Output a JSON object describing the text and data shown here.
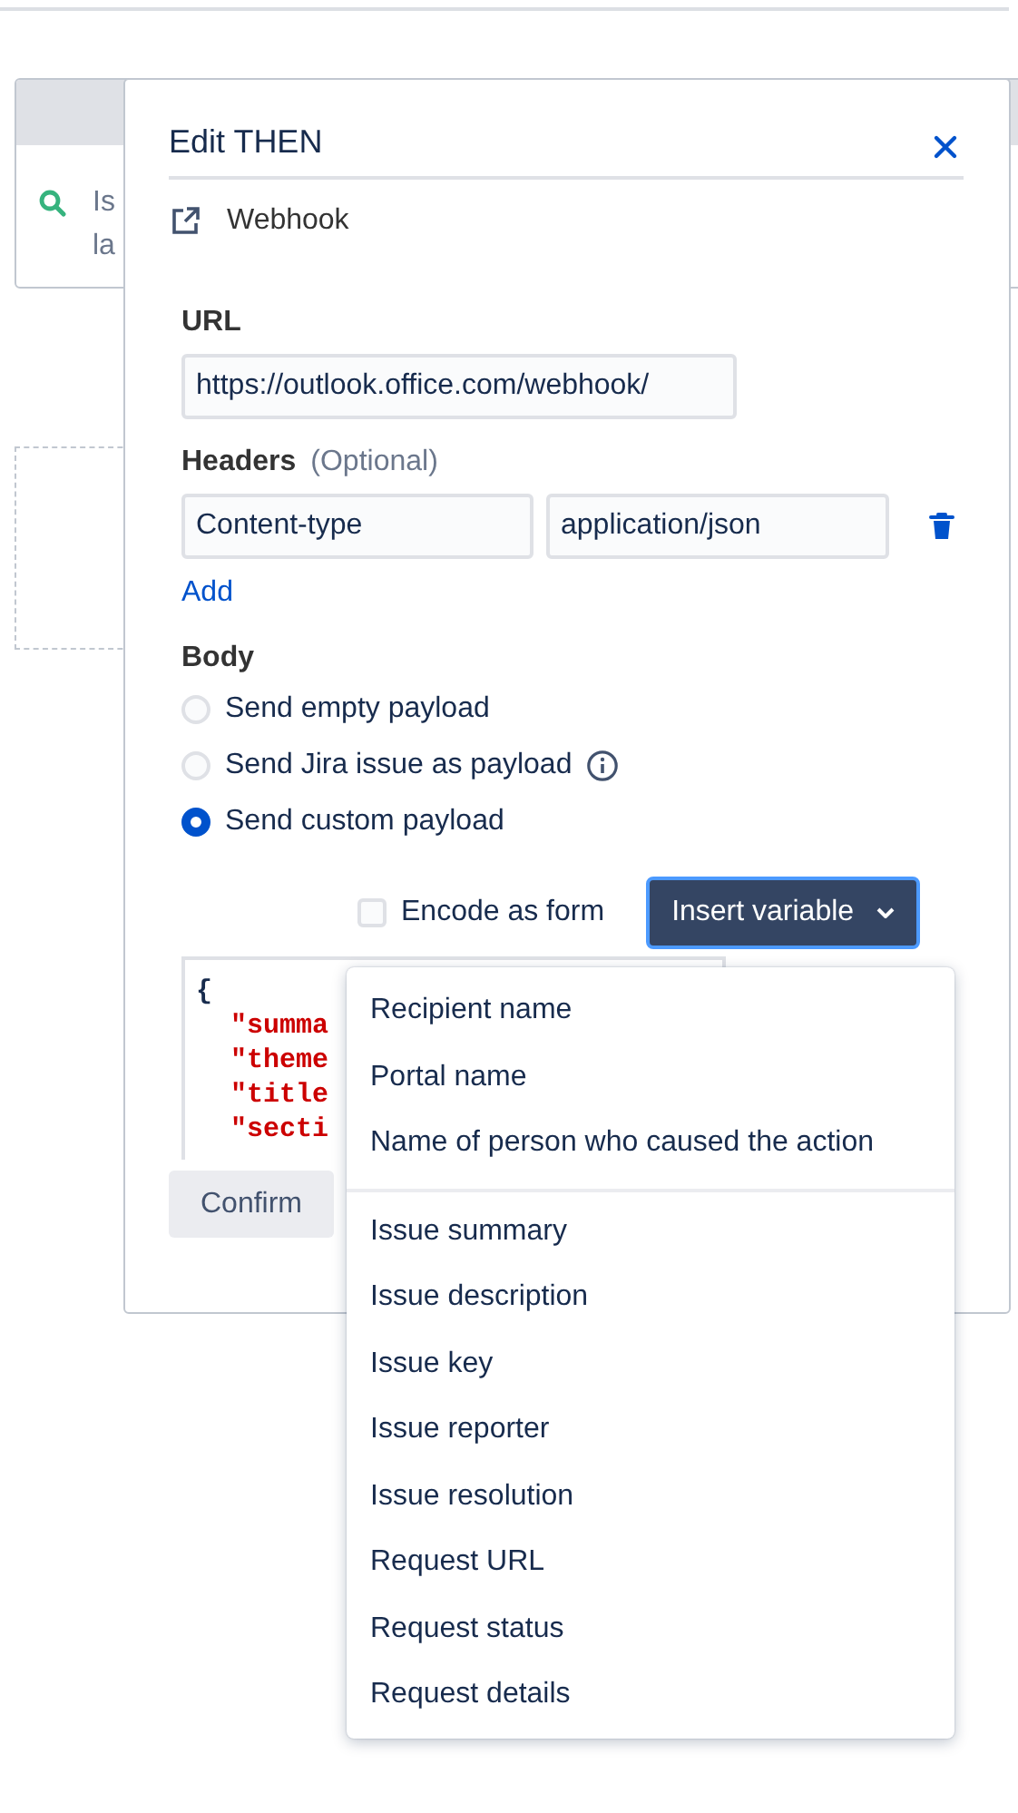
{
  "background": {
    "card_lines": [
      "Is",
      "la"
    ]
  },
  "dialog": {
    "title": "Edit THEN",
    "action": "Webhook",
    "url": {
      "label": "URL",
      "value": "https://outlook.office.com/webhook/"
    },
    "headers": {
      "label": "Headers",
      "hint": "(Optional)",
      "rows": [
        {
          "name": "Content-type",
          "value": "application/json"
        }
      ],
      "add_link": "Add"
    },
    "body": {
      "label": "Body",
      "options": [
        {
          "label": "Send empty payload",
          "selected": false,
          "info": false
        },
        {
          "label": "Send Jira issue as payload",
          "selected": false,
          "info": true
        },
        {
          "label": "Send custom payload",
          "selected": true,
          "info": false
        }
      ],
      "encode": {
        "label": "Encode as form",
        "checked": false
      },
      "insert_button": "Insert variable",
      "code_lines": [
        {
          "text": "{",
          "kind": "brace"
        },
        {
          "text": "\"summa",
          "kind": "string"
        },
        {
          "text": "\"theme",
          "kind": "string"
        },
        {
          "text": "\"title",
          "kind": "string"
        },
        {
          "text": "\"secti",
          "kind": "string"
        }
      ]
    },
    "confirm_button": "Confirm"
  },
  "variable_menu": {
    "groups": [
      [
        "Recipient name",
        "Portal name",
        "Name of person who caused the action"
      ],
      [
        "Issue summary",
        "Issue description",
        "Issue key",
        "Issue reporter",
        "Issue resolution",
        "Request URL",
        "Request status",
        "Request details"
      ]
    ]
  }
}
